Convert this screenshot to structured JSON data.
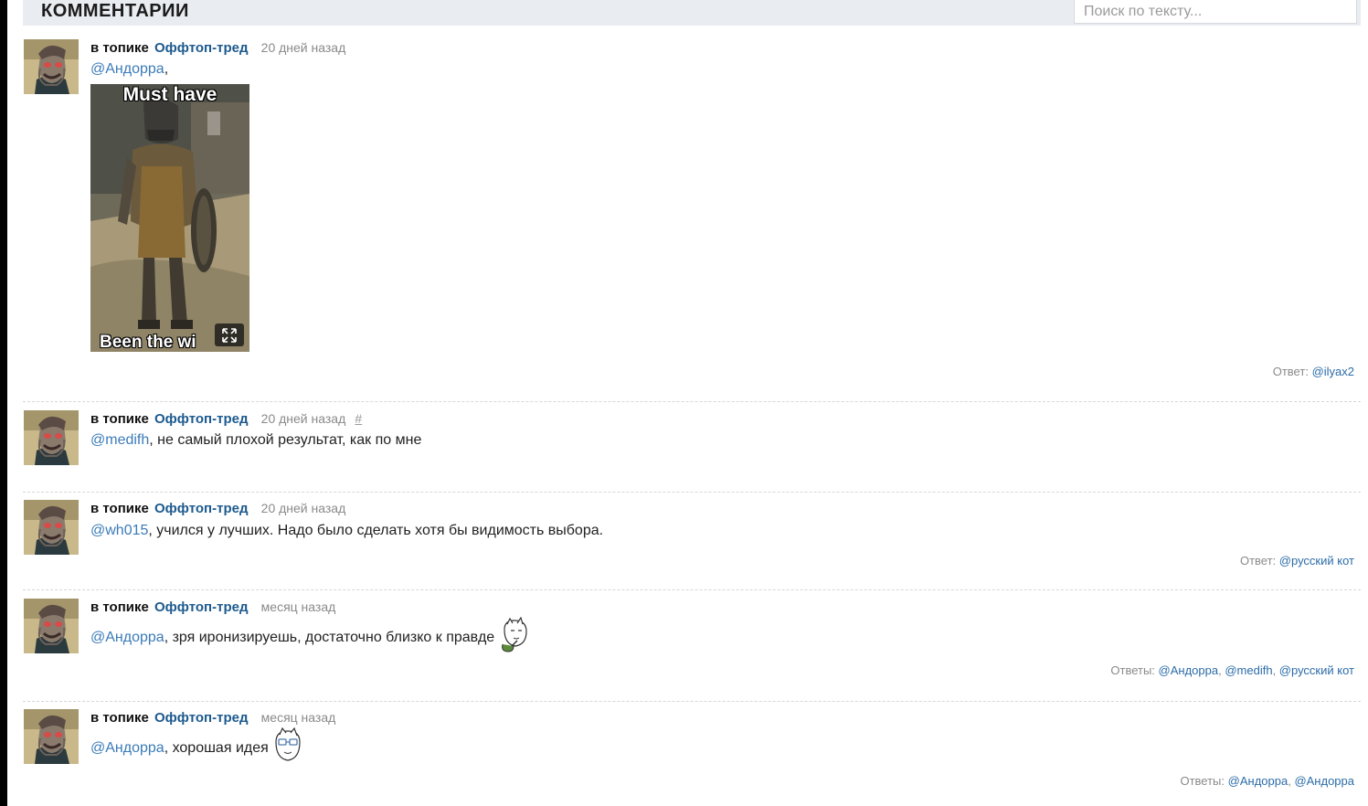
{
  "header": {
    "title": "КОММЕНТАРИИ",
    "search_placeholder": "Поиск по тексту..."
  },
  "comments": [
    {
      "in_topic": "в топике",
      "topic": "Оффтоп-тред",
      "time": "20 дней назад",
      "mention": "@Андорра",
      "text": ",",
      "image": {
        "top_caption": "Must have",
        "bottom_caption": "Been the wi"
      },
      "replies_label": "Ответ:",
      "replies": [
        "@ilyax2"
      ]
    },
    {
      "in_topic": "в топике",
      "topic": "Оффтоп-тред",
      "time": "20 дней назад",
      "hash": "#",
      "mention": "@medifh",
      "text": ", не самый плохой результат, как по мне"
    },
    {
      "in_topic": "в топике",
      "topic": "Оффтоп-тред",
      "time": "20 дней назад",
      "mention": "@wh015",
      "text": ", учился у лучших. Надо было сделать хотя бы видимость выбора.",
      "replies_label": "Ответ:",
      "replies": [
        "@русский кот"
      ]
    },
    {
      "in_topic": "в топике",
      "topic": "Оффтоп-тред",
      "time": "месяц назад",
      "mention": "@Андорра",
      "text": ", зря иронизируешь, достаточно близко к правде",
      "smiley": "pipe-smoking-face-icon",
      "replies_label": "Ответы:",
      "replies": [
        "@Андорра",
        "@medifh",
        "@русский кот"
      ]
    },
    {
      "in_topic": "в топике",
      "topic": "Оффтоп-тред",
      "time": "месяц назад",
      "mention": "@Андорра",
      "text": ", хорошая идея",
      "smiley": "glasses-face-icon",
      "replies_label": "Ответы:",
      "replies": [
        "@Андорра",
        "@Андорра"
      ]
    }
  ],
  "colors": {
    "topic_link": "#1d5a8e",
    "mention": "#3b7bb8",
    "muted": "#8a8a8a",
    "header_bg": "#e9ecf0"
  }
}
